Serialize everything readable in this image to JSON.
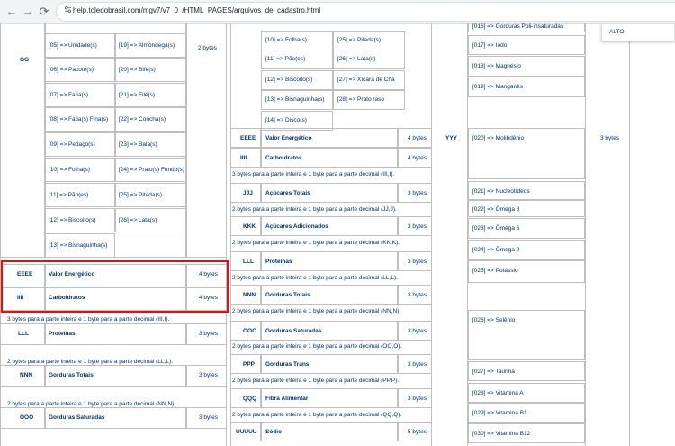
{
  "browser": {
    "url": "help.toledobrasil.com/mgv7/v7_0_/HTML_PAGES/arquivos_de_cadastro.html",
    "back_glyph": "←",
    "forward_glyph": "→",
    "reload_glyph": "⟳"
  },
  "dropdown": {
    "label": "ALTO"
  },
  "left_table": {
    "group_label": "GG",
    "size_gg": "2 bytes",
    "units_left": [
      "[05] => Unidade(s)",
      "[06] => Pacote(s)",
      "[07] => Fatia(s)",
      "[08] => Fatia(s) Fina(s)",
      "[09] => Pedaço(s)",
      "[10] => Folha(s)",
      "[11] => Pão(es)",
      "[12] => Biscoito(s)",
      "[13] => Bisnaguinha(s)"
    ],
    "units_right": [
      "[19] => Almôndega(s)",
      "[20] => Bife(s)",
      "[21] => Filé(s)",
      "[22] => Concha(s)",
      "[23] => Bala(s)",
      "[24] => Prato(s) Fundo(s)",
      "[25] => Pitada(s)",
      "[26] => Lata(s)"
    ],
    "rows": [
      {
        "code": "EEEE",
        "name": "Valor Energético",
        "size": "4 bytes"
      },
      {
        "code": "IIII",
        "name": "Carboidratos",
        "size": "4 bytes"
      },
      {
        "code": "LLL",
        "name": "Proteínas",
        "size": "3 bytes"
      },
      {
        "code": "NNN",
        "name": "Gorduras Totais",
        "size": "3 bytes"
      },
      {
        "code": "OOO",
        "name": "Gorduras Saturadas",
        "size": "3 bytes"
      }
    ],
    "notes": [
      "3 bytes para a parte inteira e 1 byte para a parte decimal (III,I).",
      "2 bytes para a parte inteira e 1 byte para a parte decimal (LL,L).",
      "2 bytes para a parte inteira e 1 byte para a parte decimal (NN,N)."
    ]
  },
  "mid_table": {
    "units_left": [
      "[10] => Folha(s)",
      "[11] => Pão(es)",
      "[12] => Biscoito(s)",
      "[13] => Bisnaguinha(s)",
      "[14] => Disco(s)"
    ],
    "units_right": [
      "[25] => Pitada(s)",
      "[26] => Lata(s)",
      "[27] => Xícara de Chá",
      "[28] => Prato raso"
    ],
    "rows": [
      {
        "code": "EEEE",
        "name": "Valor Energético",
        "size": "4 bytes"
      },
      {
        "code": "IIII",
        "name": "Carboidratos",
        "size": "4 bytes"
      },
      {
        "code": "JJJ",
        "name": "Açúcares Totais",
        "size": "3 bytes"
      },
      {
        "code": "KKK",
        "name": "Açúcares Adicionados",
        "size": "3 bytes"
      },
      {
        "code": "LLL",
        "name": "Proteínas",
        "size": "3 bytes"
      },
      {
        "code": "NNN",
        "name": "Gorduras Totais",
        "size": "3 bytes"
      },
      {
        "code": "OOO",
        "name": "Gorduras Saturadas",
        "size": "3 bytes"
      },
      {
        "code": "PPP",
        "name": "Gorduras Trans",
        "size": "3 bytes"
      },
      {
        "code": "QQQ",
        "name": "Fibra Alimentar",
        "size": "3 bytes"
      },
      {
        "code": "UUUUU",
        "name": "Sódio",
        "size": "5 bytes"
      }
    ],
    "notes": [
      "3 bytes para a parte inteira e 1 byte para a parte decimal (III,I).",
      "2 bytes para a parte inteira e 1 byte para a parte decimal (JJ,J).",
      "2 bytes para a parte inteira e 1 byte para a parte decimal (KK,K).",
      "2 bytes para a parte inteira e 1 byte para a parte decimal (LL,L).",
      "2 bytes para a parte inteira e 1 byte para a parte decimal (NN,N).",
      "2 bytes para a parte inteira e 1 byte para a parte decimal (OO,O).",
      "2 bytes para a parte inteira e 1 byte para a parte decimal (PP,P).",
      "2 bytes para a parte inteira e 1 byte para a parte decimal (QQ,Q)."
    ]
  },
  "right_table": {
    "code": "YYY",
    "size": "3 bytes",
    "items": [
      "[016] => Gorduras Poli-insaturadas",
      "[017] => Iodo",
      "[018] => Magnésio",
      "[019] => Manganês",
      "[020] => Molibdênio",
      "[021] => Nucleotídeos",
      "[022] => Ômega 3",
      "[023] => Ômega 6",
      "[024] => Ômega 9",
      "[025] => Potássio",
      "[026] => Selênio",
      "[027] => Taurina",
      "[028] => Vitamina A",
      "[029] => Vitamina B1",
      "[030] => Vitamina B12"
    ]
  }
}
